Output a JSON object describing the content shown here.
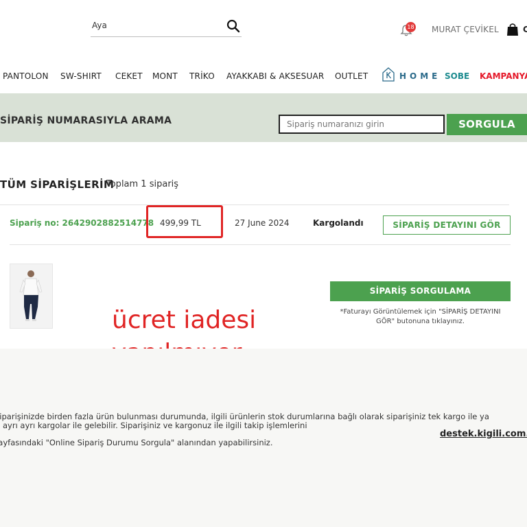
{
  "header": {
    "search_value": "Aya",
    "notification_count": "18",
    "user_name": "MURAT ÇEVİKEL",
    "bag_label": "C"
  },
  "nav": {
    "items": [
      "PANTOLON",
      "SW-SHIRT",
      "CEKET",
      "MONT",
      "TRİKO",
      "AYAKKABI & AKSESUAR",
      "OUTLET"
    ],
    "home_label": "HOME",
    "sobe_label": "SOBE",
    "kampanya_label": "KAMPANYA"
  },
  "search_band": {
    "title": "SİPARİŞ NUMARASIYLA ARAMA",
    "placeholder": "Sipariş numaranızı girin",
    "button_label": "SORGULA"
  },
  "orders": {
    "title": "TÜM SİPARİŞLERİM",
    "total": "Toplam 1 sipariş",
    "order_no": "Sipariş no: 2642902882514778",
    "price": "499,99 TL",
    "date": "27 June 2024",
    "status": "Kargolandı",
    "detail_button": "SİPARİŞ DETAYINI GÖR",
    "query_button": "SİPARİŞ SORGULAMA",
    "note": "*Faturayı Görüntülemek için \"SİPARİŞ DETAYINI GÖR\" butonuna tıklayınız."
  },
  "annotation": {
    "line1": "ücret iadesi",
    "line2": "yapılmıyor"
  },
  "footer": {
    "line1": "Siparişinizde birden fazla ürün bulunması durumunda, ilgili ürünlerin stok durumlarına bağlı olarak siparişiniz tek kargo ile ya",
    "line2": "da ayrı ayrı kargolar ile gelebilir. Siparişiniz ve kargonuz ile ilgili takip işlemlerini",
    "line3": "Sayfasındaki \"Online Sipariş Durumu Sorgula\" alanından yapabilirsiniz.",
    "support_link": "destek.kigili.com.tr"
  },
  "colors": {
    "accent_green": "#4ca14f",
    "band_bg": "#d9e1d6",
    "highlight_red": "#e02424",
    "kampanya_red": "#e5192a",
    "home_blue": "#2b6a8a",
    "sobe_teal": "#1d8b8f"
  },
  "icons": {
    "search": "search-icon",
    "bell": "bell-icon",
    "bag": "shopping-bag-icon",
    "home_logo": "k-home-logo-icon"
  }
}
